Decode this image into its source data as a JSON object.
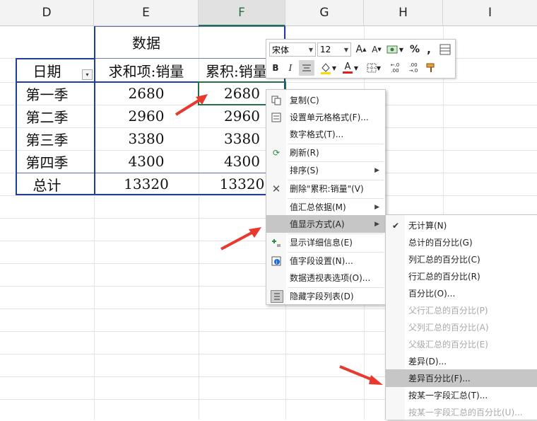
{
  "columns": [
    "D",
    "E",
    "F",
    "G",
    "H",
    "I"
  ],
  "pivot": {
    "header_data": "数据",
    "col_date": "日期",
    "col_sum": "求和项:销量",
    "col_cum": "累积:销量",
    "rows": [
      {
        "label": "第一季",
        "sum": "2680",
        "cum": "2680"
      },
      {
        "label": "第二季",
        "sum": "2960",
        "cum": "2960"
      },
      {
        "label": "第三季",
        "sum": "3380",
        "cum": "3380"
      },
      {
        "label": "第四季",
        "sum": "4300",
        "cum": "4300"
      }
    ],
    "total": {
      "label": "总计",
      "sum": "13320",
      "cum": "13320"
    }
  },
  "mini_toolbar": {
    "font": "宋体",
    "size": "12",
    "grow_font": "A",
    "shrink_font": "A",
    "percent": "%",
    "comma": ",",
    "bold": "B",
    "italic": "I",
    "font_color_letter": "A",
    "inc_decimal": "←.0 .00",
    "dec_decimal": ".00 →.0"
  },
  "context_menu": [
    {
      "label": "复制(C)",
      "icon": "copy-icon"
    },
    {
      "label": "设置单元格格式(F)...",
      "icon": "format-cells-icon"
    },
    {
      "label": "数字格式(T)...",
      "icon": ""
    },
    {
      "label": "刷新(R)",
      "icon": "refresh-icon"
    },
    {
      "label": "排序(S)",
      "icon": "",
      "submenu": true
    },
    {
      "label": "删除\"累积:销量\"(V)",
      "icon": "delete-icon"
    },
    {
      "label": "值汇总依据(M)",
      "icon": "",
      "submenu": true
    },
    {
      "label": "值显示方式(A)",
      "icon": "",
      "submenu": true,
      "highlight": true
    },
    {
      "label": "显示详细信息(E)",
      "icon": "show-details-icon"
    },
    {
      "label": "值字段设置(N)...",
      "icon": "field-settings-icon"
    },
    {
      "label": "数据透视表选项(O)...",
      "icon": ""
    },
    {
      "label": "隐藏字段列表(D)",
      "icon": "field-list-icon"
    }
  ],
  "submenu": [
    {
      "label": "无计算(N)",
      "checked": true,
      "enabled": true
    },
    {
      "label": "总计的百分比(G)",
      "enabled": true
    },
    {
      "label": "列汇总的百分比(C)",
      "enabled": true
    },
    {
      "label": "行汇总的百分比(R)",
      "enabled": true
    },
    {
      "label": "百分比(O)...",
      "enabled": true
    },
    {
      "label": "父行汇总的百分比(P)",
      "enabled": false
    },
    {
      "label": "父列汇总的百分比(A)",
      "enabled": false
    },
    {
      "label": "父级汇总的百分比(E)",
      "enabled": false
    },
    {
      "label": "差异(D)...",
      "enabled": true
    },
    {
      "label": "差异百分比(F)...",
      "enabled": true,
      "highlight": true
    },
    {
      "label": "按某一字段汇总(T)...",
      "enabled": true
    },
    {
      "label": "按某一字段汇总的百分比(U)...",
      "enabled": false
    }
  ],
  "colors": {
    "accent_green": "#217346",
    "pivot_border": "#1f3f9e",
    "arrow_red": "#e8392f"
  }
}
